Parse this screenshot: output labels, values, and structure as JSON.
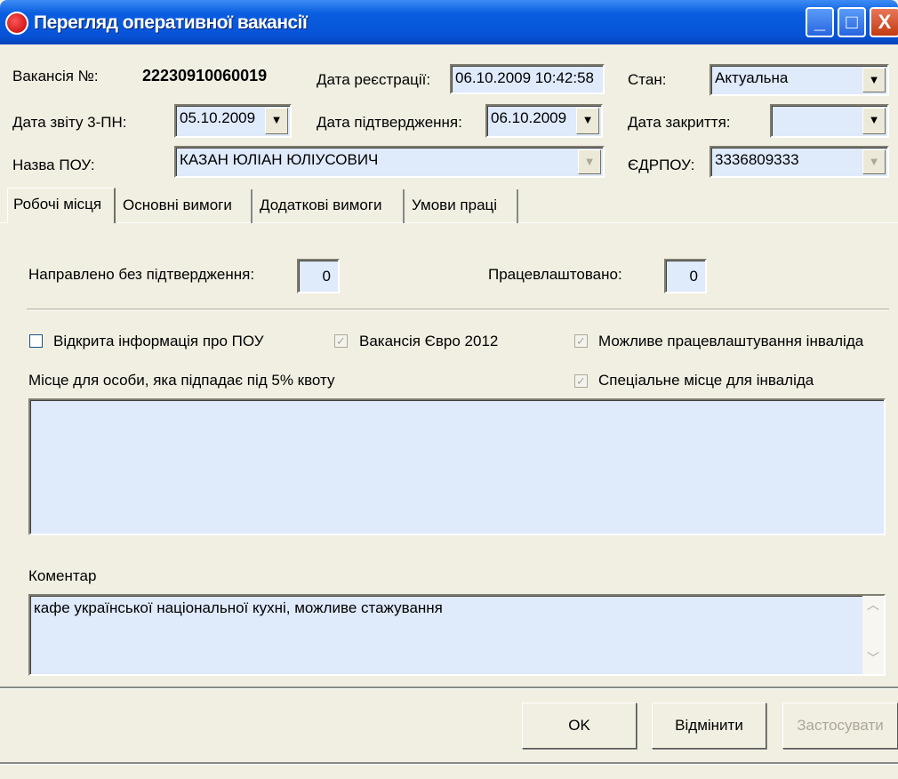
{
  "window": {
    "title": "Перегляд оперативної вакансії",
    "minimize": "_",
    "maximize": "□",
    "close": "X"
  },
  "header": {
    "vacancy_label": "Вакансія №:",
    "vacancy_number": "22230910060019",
    "reg_date_label": "Дата реєстрації:",
    "reg_date": "06.10.2009 10:42:58",
    "state_label": "Стан:",
    "state": "Актуальна",
    "report_date_label": "Дата звіту 3-ПН:",
    "report_date": "05.10.2009",
    "confirm_date_label": "Дата підтвердження:",
    "confirm_date": "06.10.2009",
    "close_date_label": "Дата закриття:",
    "close_date": "",
    "employer_label": "Назва ПОУ:",
    "employer": "КАЗАН ЮЛІАН ЮЛІУСОВИЧ",
    "edrpou_label": "ЄДРПОУ:",
    "edrpou": "3336809333"
  },
  "tabs": [
    {
      "label": "Робочі місця",
      "active": true
    },
    {
      "label": "Основні вимоги"
    },
    {
      "label": "Додаткові вимоги"
    },
    {
      "label": "Умови праці"
    }
  ],
  "panel": {
    "sent_label": "Направлено без підтвердження:",
    "sent_value": "0",
    "employed_label": "Працевлаштовано:",
    "employed_value": "0",
    "checkboxes": [
      {
        "label": "Відкрита інформація про ПОУ",
        "checked": false,
        "enabled": true
      },
      {
        "label": "Вакансія Євро 2012",
        "checked": true,
        "enabled": false
      },
      {
        "label": "Можливе працевлаштування інваліда",
        "checked": true,
        "enabled": false
      },
      {
        "label": "Спеціальне місце для інваліда",
        "checked": true,
        "enabled": false
      }
    ],
    "quota_label": "Місце для особи, яка підпадає під 5% квоту",
    "quota_text": "",
    "comment_label": "Коментар",
    "comment": "кафе української національної кухні, можливе стажування"
  },
  "buttons": {
    "ok": "OK",
    "cancel": "Відмінити",
    "apply": "Застосувати"
  },
  "icons": {
    "dropdown": "▼",
    "check": "✓",
    "scroll_up": "︿",
    "scroll_down": "﹀"
  }
}
